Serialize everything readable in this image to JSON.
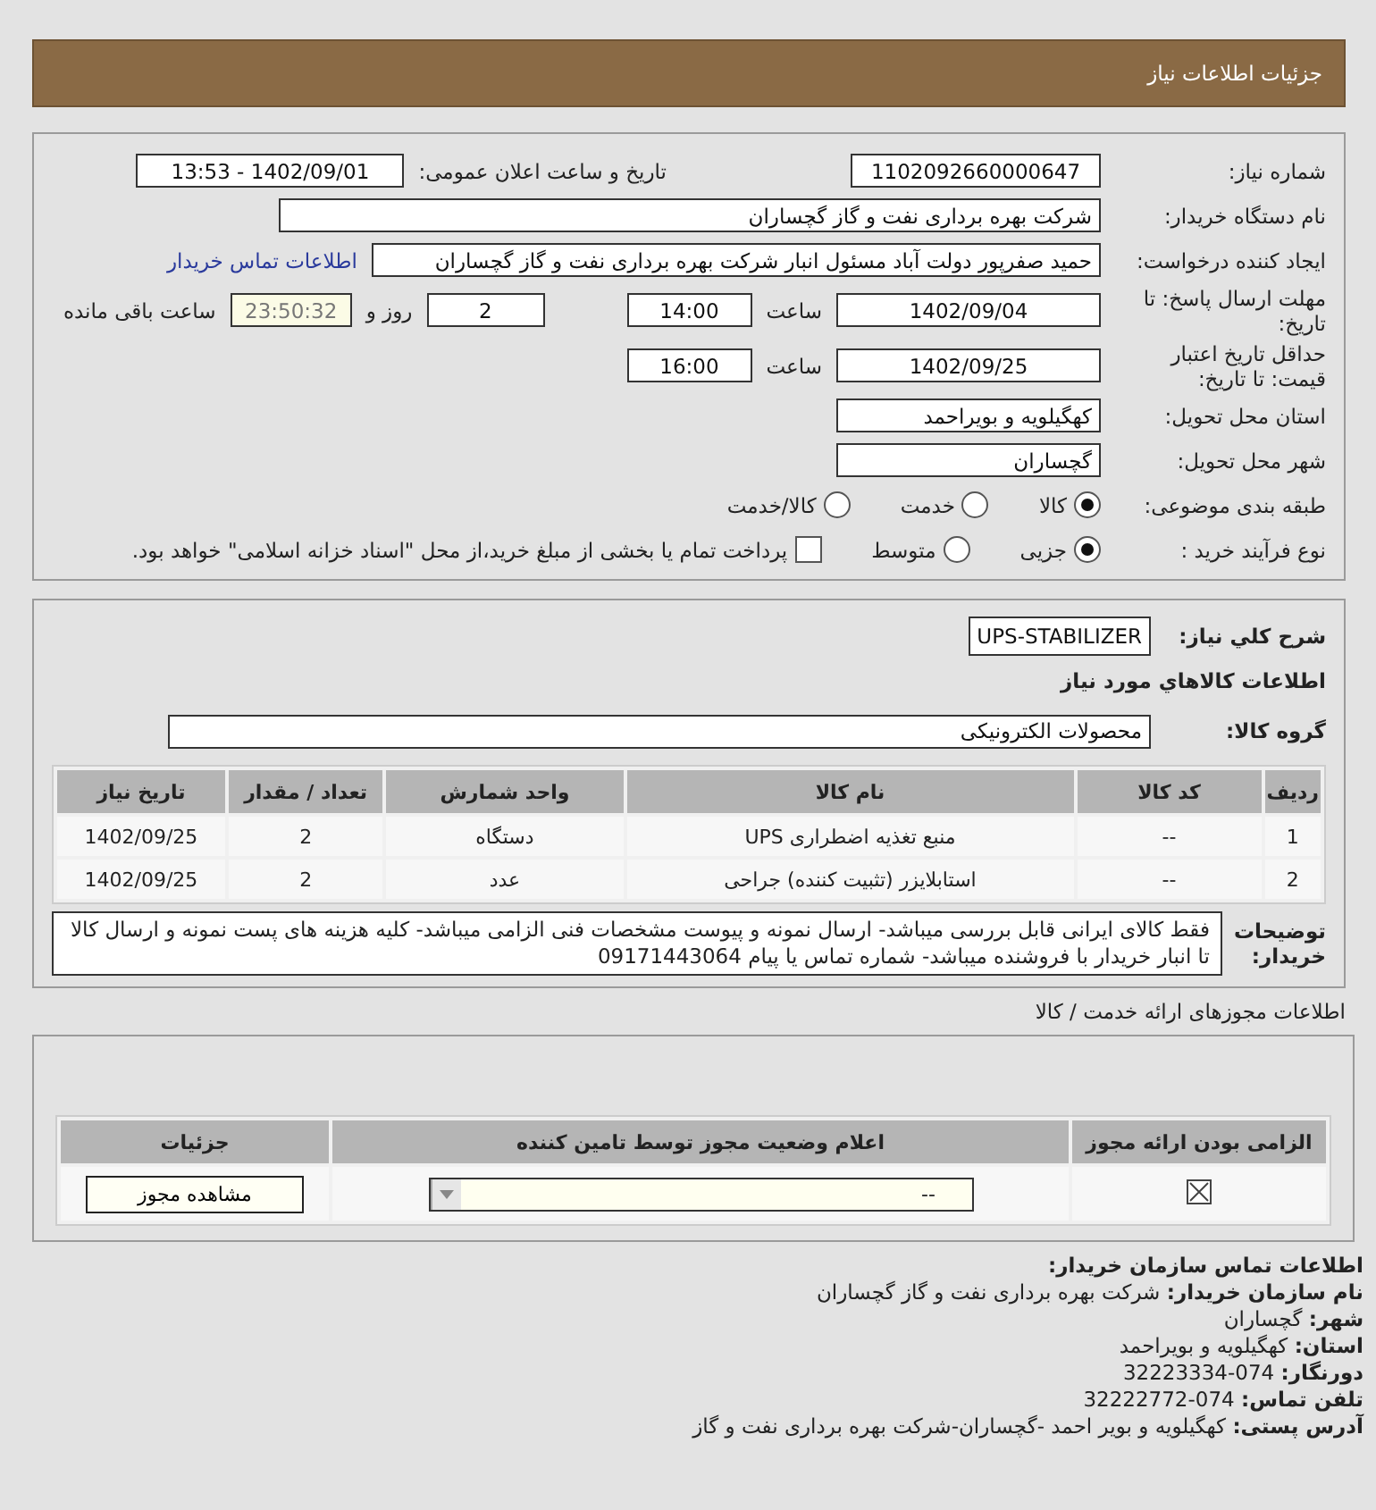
{
  "header": {
    "title": "جزئیات اطلاعات نیاز"
  },
  "need": {
    "number": {
      "label": "شماره نیاز:",
      "value": "1102092660000647"
    },
    "announce": {
      "label": "تاریخ و ساعت اعلان عمومی:",
      "value": "1402/09/01 - 13:53"
    },
    "buyer_org": {
      "label": "نام دستگاه خریدار:",
      "value": "شرکت بهره برداری نفت و گاز گچساران"
    },
    "requester": {
      "label": "ایجاد کننده درخواست:",
      "value": "حمید  صفرپور دولت آباد مسئول انبار شرکت بهره برداری نفت و گاز گچساران",
      "link": "اطلاعات تماس خریدار"
    },
    "reply_deadline": {
      "label": "مهلت ارسال پاسخ: تا تاریخ:",
      "date": "1402/09/04",
      "time_label": "ساعت",
      "time": "14:00",
      "days": "2",
      "days_label": "روز و",
      "remaining": "23:50:32",
      "remaining_label": "ساعت باقی مانده"
    },
    "validity": {
      "label": "حداقل تاریخ اعتبار قیمت: تا تاریخ:",
      "date": "1402/09/25",
      "time_label": "ساعت",
      "time": "16:00"
    },
    "province": {
      "label": "استان محل تحویل:",
      "value": "کهگیلویه و بویراحمد"
    },
    "city": {
      "label": "شهر محل تحویل:",
      "value": "گچساران"
    },
    "category": {
      "label": "طبقه بندی موضوعی:",
      "options": [
        {
          "label": "کالا",
          "selected": true
        },
        {
          "label": "خدمت",
          "selected": false
        },
        {
          "label": "کالا/خدمت",
          "selected": false
        }
      ]
    },
    "process": {
      "label": "نوع فرآیند خرید :",
      "options": [
        {
          "label": "جزیی",
          "selected": true
        },
        {
          "label": "متوسط",
          "selected": false
        }
      ],
      "treasury": {
        "label": "پرداخت تمام یا بخشی از مبلغ خرید،از محل \"اسناد خزانه اسلامی\" خواهد بود.",
        "checked": false
      }
    }
  },
  "goods": {
    "summary": {
      "label": "شرح کلي نياز:",
      "value": "UPS-STABILIZER"
    },
    "heading": "اطلاعات کالاهاي مورد نياز",
    "group": {
      "label": "گروه کالا:",
      "value": "محصولات الکترونیکی"
    },
    "table": {
      "columns": [
        "ردیف",
        "کد کالا",
        "نام کالا",
        "واحد شمارش",
        "تعداد / مقدار",
        "تاریخ نیاز"
      ],
      "rows": [
        [
          "1",
          "--",
          "منبع تغذیه اضطراری UPS",
          "دستگاه",
          "2",
          "1402/09/25"
        ],
        [
          "2",
          "--",
          "استابلایزر (تثبیت کننده) جراحی",
          "عدد",
          "2",
          "1402/09/25"
        ]
      ]
    },
    "description": {
      "label": "توضیحات خریدار:",
      "text": "فقط کالای ایرانی قابل بررسی میباشد- ارسال نمونه و پیوست مشخصات فنی الزامی میباشد- کلیه هزینه های پست نمونه و ارسال کالا تا انبار خریدار با فروشنده میباشد- شماره تماس یا پیام 09171443064"
    }
  },
  "permits": {
    "title": "اطلاعات مجوزهای ارائه خدمت / کالا",
    "columns": [
      "الزامی بودن ارائه مجوز",
      "اعلام وضعیت مجوز توسط تامین کننده",
      "جزئیات"
    ],
    "rows": [
      {
        "required": true,
        "status": "--",
        "button": "مشاهده مجوز"
      }
    ]
  },
  "contact": {
    "title": "اطلاعات تماس سازمان خریدار:",
    "lines": [
      {
        "label": "نام سازمان خریدار:",
        "value": "شرکت بهره برداری نفت و گاز گچساران"
      },
      {
        "label": "شهر:",
        "value": "گچساران"
      },
      {
        "label": "استان:",
        "value": "کهگیلویه و بویراحمد"
      },
      {
        "label": "دورنگار:",
        "value": "074-32223334"
      },
      {
        "label": "تلفن تماس:",
        "value": "074-32222772"
      },
      {
        "label": "آدرس پستی:",
        "value": "کهگیلویه و بویر احمد -گچساران-شرکت بهره برداری نفت و گاز"
      }
    ]
  }
}
